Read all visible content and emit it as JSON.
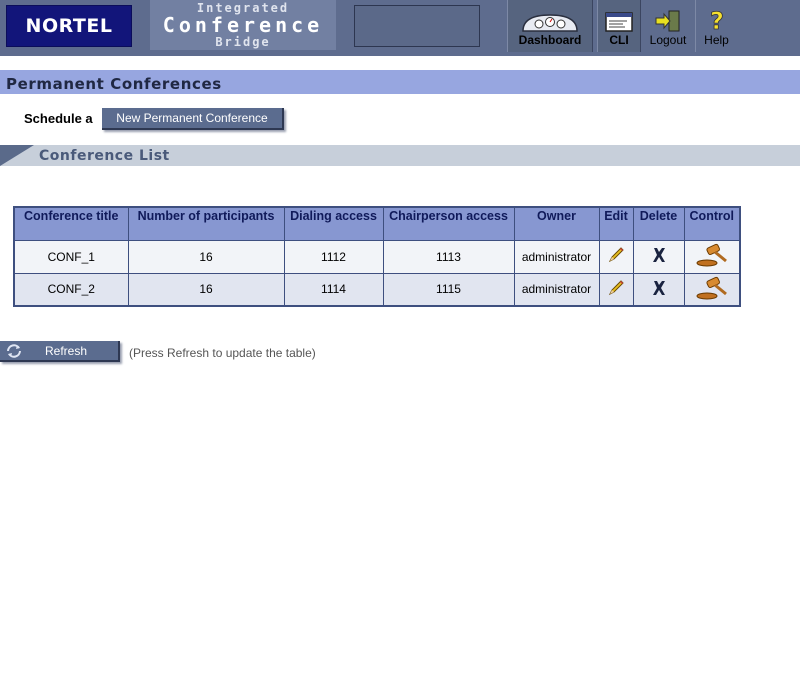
{
  "header": {
    "logo": "NORTEL",
    "product": {
      "line1": "Integrated",
      "line2": "Conference",
      "line3": "Bridge"
    },
    "nav": [
      {
        "label": "Dashboard",
        "icon": "dashboard-gauge-icon"
      },
      {
        "label": "CLI",
        "icon": "terminal-icon"
      },
      {
        "label": "Logout",
        "icon": "logout-door-icon"
      },
      {
        "label": "Help",
        "icon": "question-mark-icon"
      }
    ]
  },
  "page": {
    "title": "Permanent Conferences",
    "schedule_label": "Schedule a",
    "new_button": "New Permanent Conference",
    "section_title": "Conference List"
  },
  "table": {
    "headers": [
      "Conference title",
      "Number of participants",
      "Dialing access",
      "Chairperson access",
      "Owner",
      "Edit",
      "Delete",
      "Control"
    ],
    "rows": [
      {
        "title": "CONF_1",
        "participants": "16",
        "dialing": "1112",
        "chairperson": "1113",
        "owner": "administrator"
      },
      {
        "title": "CONF_2",
        "participants": "16",
        "dialing": "1114",
        "chairperson": "1115",
        "owner": "administrator"
      }
    ]
  },
  "refresh": {
    "button": "Refresh",
    "note": "(Press Refresh to update the table)"
  },
  "colors": {
    "header_bg": "#5e6c8e",
    "logo_bg": "#12157a",
    "title_bar": "#97a6e0",
    "table_header": "#8797d1",
    "button": "#5b6c8f"
  }
}
